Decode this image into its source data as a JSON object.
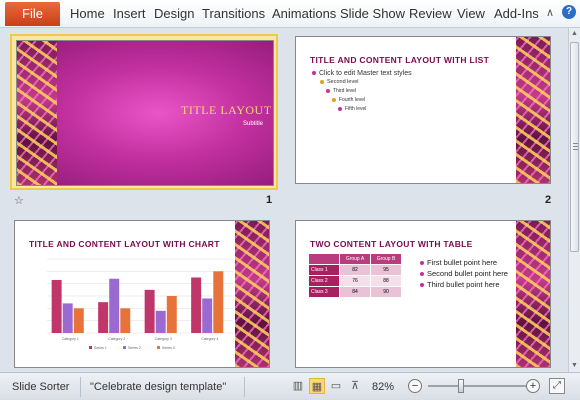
{
  "ribbon": {
    "file_label": "File",
    "tabs": [
      "Home",
      "Insert",
      "Design",
      "Transitions",
      "Animations",
      "Slide Show",
      "Review",
      "View",
      "Add-Ins"
    ],
    "help_glyph": "∧",
    "help_icon": "?"
  },
  "slides": [
    {
      "number": "1",
      "title": "TITLE LAYOUT",
      "subtitle": "Subtitle"
    },
    {
      "number": "2",
      "title": "TITLE AND CONTENT LAYOUT WITH LIST",
      "items": [
        "Click to edit Master text styles",
        "Second level",
        "Third level",
        "Fourth level",
        "Fifth level"
      ]
    },
    {
      "number": "",
      "title": "TITLE AND CONTENT LAYOUT WITH CHART"
    },
    {
      "number": "",
      "title": "TWO CONTENT LAYOUT WITH TABLE",
      "table": {
        "headers": [
          "",
          "Group A",
          "Group B"
        ],
        "rows": [
          [
            "Class 1",
            "82",
            "95"
          ],
          [
            "Class 2",
            "76",
            "88"
          ],
          [
            "Class 3",
            "84",
            "90"
          ]
        ]
      },
      "bullets": [
        "First bullet point here",
        "Second bullet point here",
        "Third bullet point here"
      ]
    }
  ],
  "chart_data": {
    "type": "bar",
    "categories": [
      "Category 1",
      "Category 2",
      "Category 3",
      "Category 4"
    ],
    "series": [
      {
        "name": "Series 1",
        "values": [
          4.3,
          2.5,
          3.5,
          4.5
        ]
      },
      {
        "name": "Series 2",
        "values": [
          2.4,
          4.4,
          1.8,
          2.8
        ]
      },
      {
        "name": "Series 3",
        "values": [
          2,
          2,
          3,
          5
        ]
      }
    ],
    "ylim": [
      0,
      6
    ],
    "colors": [
      "#c0356a",
      "#9a6ad0",
      "#e8733a"
    ]
  },
  "status": {
    "view_name": "Slide Sorter",
    "theme": "\"Celebrate design template\"",
    "zoom": "82%",
    "zoom_out": "−",
    "zoom_in": "+"
  }
}
